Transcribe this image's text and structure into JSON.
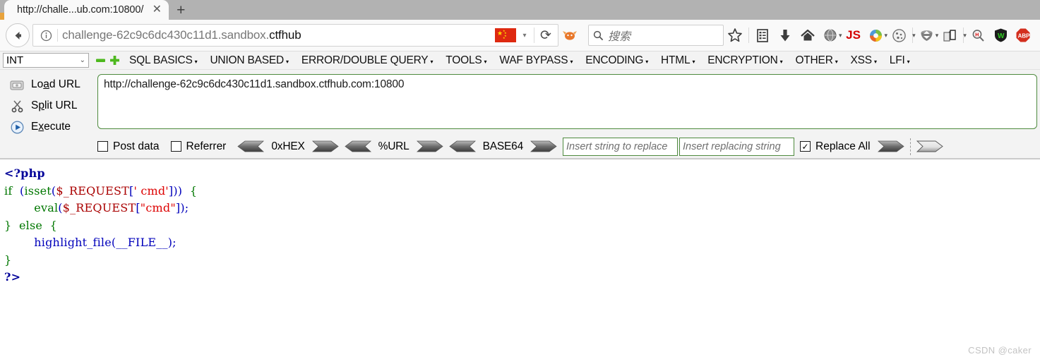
{
  "browser": {
    "tab": {
      "title": "http://challe...ub.com:10800/",
      "close_label": "✕"
    },
    "new_tab_label": "+",
    "back_icon": "back-arrow-icon",
    "address": {
      "prefix": "challenge-62c9c6dc430c11d1.sandbox.",
      "suffix": "ctfhub",
      "full": "challenge-62c9c6dc430c11d1.sandbox.ctfhub",
      "flag": "china-flag-icon",
      "dropdown_caret": "▾",
      "reload_label": "⟳",
      "info_icon": "info-circle-icon"
    },
    "search": {
      "placeholder": "搜索",
      "icon": "search-icon"
    },
    "toolbar_icons": [
      {
        "name": "firefox-extension-icon",
        "glyph": ""
      },
      {
        "name": "bookmark-star-icon",
        "glyph": "☆"
      },
      {
        "name": "library-icon",
        "glyph": ""
      },
      {
        "name": "downloads-icon",
        "glyph": "⬇"
      },
      {
        "name": "home-icon",
        "glyph": "⌂"
      },
      {
        "name": "globe-extension-icon",
        "glyph": ""
      },
      {
        "name": "js-toggle-icon",
        "glyph": "JS"
      },
      {
        "name": "colorful-extension-icon",
        "glyph": ""
      },
      {
        "name": "cookie-manager-icon",
        "glyph": ""
      },
      {
        "name": "proxy-switch-icon",
        "glyph": ""
      },
      {
        "name": "tamper-data-icon",
        "glyph": ""
      },
      {
        "name": "hackbar-search-icon",
        "glyph": ""
      },
      {
        "name": "wappalyzer-shield-icon",
        "glyph": "W"
      },
      {
        "name": "adblock-plus-icon",
        "glyph": "ABP"
      }
    ]
  },
  "hackbar": {
    "type_select": {
      "value": "INT",
      "caret": "⌄"
    },
    "minus_label": "─",
    "plus_label": "✚",
    "menus": [
      {
        "label": "SQL BASICS"
      },
      {
        "label": "UNION BASED"
      },
      {
        "label": "ERROR/DOUBLE QUERY"
      },
      {
        "label": "TOOLS"
      },
      {
        "label": "WAF BYPASS"
      },
      {
        "label": "ENCODING"
      },
      {
        "label": "HTML"
      },
      {
        "label": "ENCRYPTION"
      },
      {
        "label": "OTHER"
      },
      {
        "label": "XSS"
      },
      {
        "label": "LFI"
      }
    ],
    "menu_caret": "▾",
    "actions": [
      {
        "name": "load-url",
        "pre": "Lo",
        "accel": "a",
        "post": "d URL",
        "icon": "load-url-icon"
      },
      {
        "name": "split-url",
        "pre": "S",
        "accel": "p",
        "post": "lit URL",
        "icon": "scissors-icon"
      },
      {
        "name": "execute",
        "pre": "E",
        "accel": "x",
        "post": "ecute",
        "icon": "play-icon"
      }
    ],
    "url_value": "http://challenge-62c9c6dc430c11d1.sandbox.ctfhub.com:10800",
    "options": {
      "post_data": {
        "label": "Post data",
        "checked": false
      },
      "referrer": {
        "label": "Referrer",
        "checked": false
      },
      "encoders": [
        {
          "label": "0xHEX"
        },
        {
          "label": "%URL"
        },
        {
          "label": "BASE64"
        }
      ],
      "search_placeholder": "Insert string to replace",
      "replace_placeholder": "Insert replacing string",
      "replace_all": {
        "label": "Replace All",
        "checked": true,
        "check_glyph": "✓"
      },
      "arrow_left": "◀",
      "arrow_right": "▶"
    }
  },
  "page": {
    "code_lines": [
      [
        {
          "t": "<?php",
          "c": "c-tag"
        }
      ],
      [
        {
          "t": "if",
          "c": "c-kw"
        },
        {
          "t": "  ",
          "c": ""
        },
        {
          "t": "(",
          "c": "c-blue"
        },
        {
          "t": "isset",
          "c": "c-kw"
        },
        {
          "t": "(",
          "c": "c-blue"
        },
        {
          "t": "$_REQUEST",
          "c": "c-var"
        },
        {
          "t": "[",
          "c": "c-blue"
        },
        {
          "t": "' cmd'",
          "c": "c-str"
        },
        {
          "t": "]))",
          "c": "c-blue"
        },
        {
          "t": "  ",
          "c": ""
        },
        {
          "t": "{",
          "c": "c-punct"
        }
      ],
      [
        {
          "t": "        ",
          "c": ""
        },
        {
          "t": "eval",
          "c": "c-kw"
        },
        {
          "t": "(",
          "c": "c-blue"
        },
        {
          "t": "$_REQUEST",
          "c": "c-var"
        },
        {
          "t": "[",
          "c": "c-blue"
        },
        {
          "t": "\"cmd\"",
          "c": "c-str"
        },
        {
          "t": "]);",
          "c": "c-blue"
        }
      ],
      [
        {
          "t": "}",
          "c": "c-punct"
        },
        {
          "t": "  ",
          "c": ""
        },
        {
          "t": "else",
          "c": "c-kw"
        },
        {
          "t": "  ",
          "c": ""
        },
        {
          "t": "{",
          "c": "c-punct"
        }
      ],
      [
        {
          "t": "        ",
          "c": ""
        },
        {
          "t": "highlight_file",
          "c": "c-fn"
        },
        {
          "t": "(",
          "c": "c-blue"
        },
        {
          "t": "__FILE__",
          "c": "c-fn"
        },
        {
          "t": ");",
          "c": "c-blue"
        }
      ],
      [
        {
          "t": "}",
          "c": "c-punct"
        }
      ],
      [
        {
          "t": "?>",
          "c": "c-tag"
        }
      ]
    ],
    "watermark": "CSDN @caker"
  }
}
